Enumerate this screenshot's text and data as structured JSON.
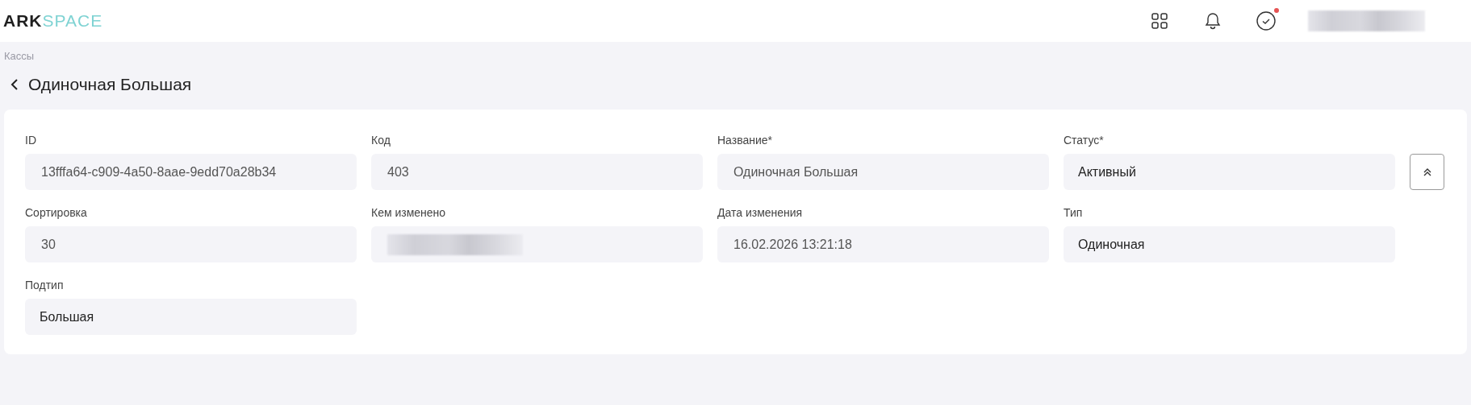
{
  "header": {
    "logo": {
      "primary": "ARK",
      "accent": "SPACE"
    },
    "actions": [
      {
        "kind": "apps",
        "badge": false
      },
      {
        "kind": "bell",
        "badge": false
      },
      {
        "kind": "tasks",
        "badge": true
      }
    ],
    "user": {
      "redacted": true
    }
  },
  "breadcrumb": "Кассы",
  "title": "Одиночная Большая",
  "fields": [
    {
      "label": "ID",
      "value": "13fffa64-c909-4a50-8aae-9edd70a28b34",
      "disabled": true
    },
    {
      "label": "Код",
      "value": "403",
      "disabled": true
    },
    {
      "label": "Название*",
      "value": "Одиночная Большая",
      "disabled": true
    },
    {
      "label": "Статус*",
      "value": "Активный",
      "disabled": false
    },
    {
      "label": "Сортировка",
      "value": "30",
      "disabled": true
    },
    {
      "label": "Кем изменено",
      "redacted": true,
      "disabled": true
    },
    {
      "label": "Дата изменения",
      "value": "16.02.2026 13:21:18",
      "disabled": true
    },
    {
      "label": "Тип",
      "value": "Одиночная",
      "disabled": false
    },
    {
      "label": "Подтип",
      "value": "Большая",
      "disabled": false
    }
  ],
  "collapse_button": {
    "expanded": true
  }
}
